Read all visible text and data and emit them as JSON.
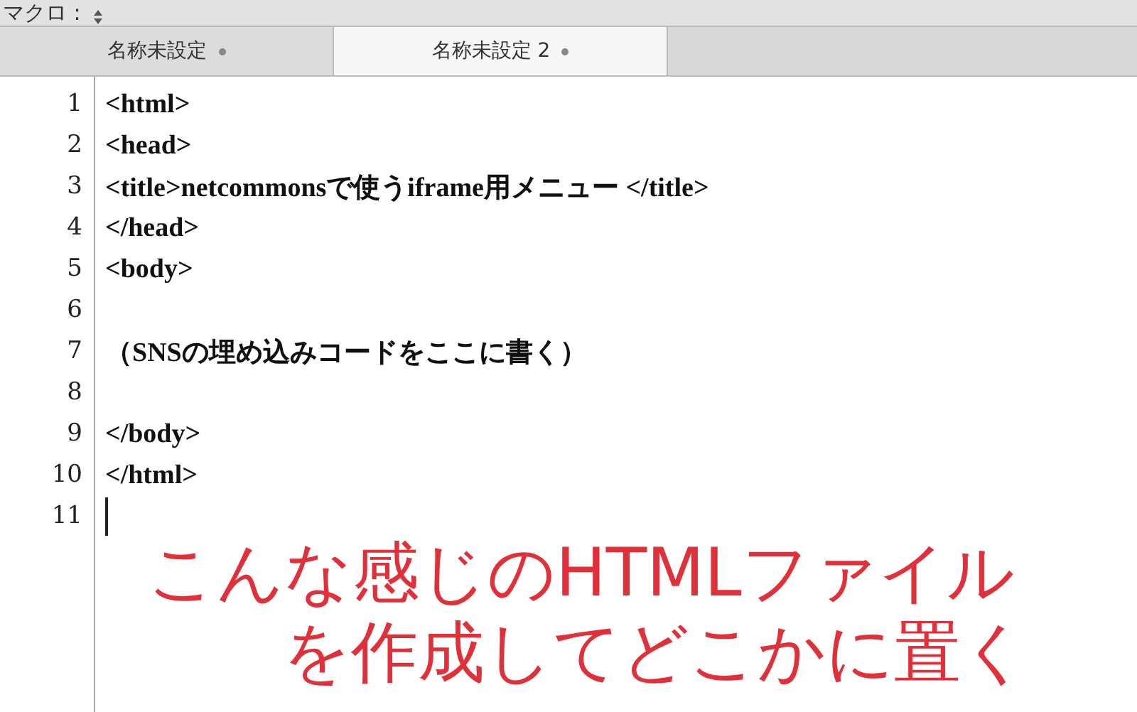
{
  "toolbar": {
    "label": "マクロ :"
  },
  "tabs": [
    {
      "label": "名称未設定",
      "selected": false,
      "modified": true
    },
    {
      "label": "名称未設定 2",
      "selected": true,
      "modified": true
    }
  ],
  "editor": {
    "lines": [
      {
        "number": "1",
        "text": "<html>"
      },
      {
        "number": "2",
        "text": "<head>"
      },
      {
        "number": "3",
        "text": "<title>netcommonsで使うiframe用メニュー </title>"
      },
      {
        "number": "4",
        "text": "</head>"
      },
      {
        "number": "5",
        "text": "<body>"
      },
      {
        "number": "6"
      },
      {
        "number": "7",
        "text": "（SNSの埋め込みコードをここに書く）"
      },
      {
        "number": "8"
      },
      {
        "number": "9",
        "text": "</body>"
      },
      {
        "number": "10",
        "text": "</html>"
      },
      {
        "number": "11",
        "cursor": true
      }
    ]
  },
  "annotation": [
    "こんな感じのHTMLファイル",
    "を作成してどこかに置く"
  ]
}
